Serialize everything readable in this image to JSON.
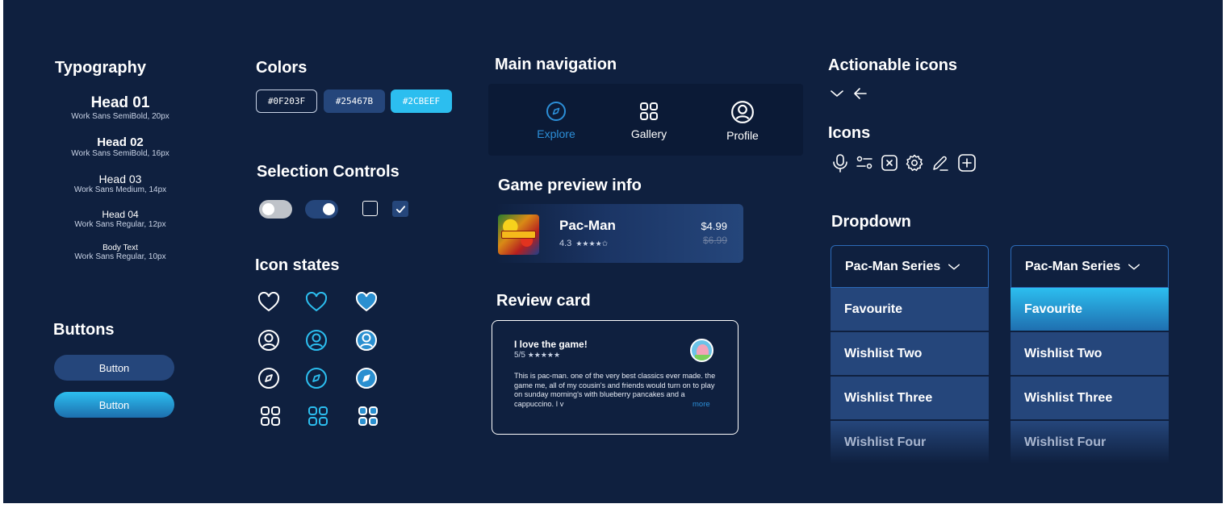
{
  "typography": {
    "heading": "Typography",
    "samples": [
      {
        "title": "Head 01",
        "spec": "Work Sans SemiBold, 20px"
      },
      {
        "title": "Head 02",
        "spec": "Work Sans SemiBold, 16px"
      },
      {
        "title": "Head 03",
        "spec": "Work Sans Medium, 14px"
      },
      {
        "title": "Head 04",
        "spec": "Work Sans Regular, 12px"
      },
      {
        "title": "Body Text",
        "spec": "Work Sans Regular, 10px"
      }
    ]
  },
  "buttons": {
    "heading": "Buttons",
    "primary_label": "Button",
    "secondary_label": "Button"
  },
  "colors": {
    "heading": "Colors",
    "swatches": [
      "#0F203F",
      "#25467B",
      "#2CBEEF"
    ]
  },
  "selection": {
    "heading": "Selection Controls",
    "toggle_off": false,
    "toggle_on": true,
    "checkbox_unchecked": false,
    "checkbox_checked": true
  },
  "icon_states": {
    "heading": "Icon states",
    "rows": [
      "heart-icon",
      "profile-icon",
      "compass-icon",
      "gallery-icon"
    ],
    "states": [
      "default",
      "outlined-active",
      "filled-active"
    ]
  },
  "main_nav": {
    "heading": "Main navigation",
    "items": [
      {
        "label": "Explore",
        "icon": "compass-icon",
        "active": true
      },
      {
        "label": "Gallery",
        "icon": "gallery-icon",
        "active": false
      },
      {
        "label": "Profile",
        "icon": "profile-icon",
        "active": false
      }
    ]
  },
  "game_preview": {
    "heading": "Game preview info",
    "title": "Pac-Man",
    "rating": "4.3",
    "stars": "★★★★✩",
    "price": "$4.99",
    "old_price": "$6.99"
  },
  "review_card": {
    "heading": "Review card",
    "title": "I love the game!",
    "rating": "5/5",
    "stars": "★★★★★",
    "body": "This is pac-man. one of the very best classics ever made. the game me, all of my cousin's and friends would turn on to play on sunday morning's with blueberry pancakes and a cappuccino. I v",
    "more": "more"
  },
  "actionable_icons": {
    "heading": "Actionable icons",
    "icons": [
      "chevron-down-icon",
      "arrow-left-icon"
    ]
  },
  "icons": {
    "heading": "Icons",
    "icons": [
      "microphone-icon",
      "filter-icon",
      "close-box-icon",
      "gear-icon",
      "edit-icon",
      "add-box-icon"
    ]
  },
  "dropdown": {
    "heading": "Dropdown",
    "selected": "Pac-Man Series",
    "options": [
      "Favourite",
      "Wishlist Two",
      "Wishlist Three",
      "Wishlist Four"
    ]
  },
  "theme": {
    "background": "#0F203F",
    "primary": "#25467B",
    "accent": "#2CBEEF"
  }
}
